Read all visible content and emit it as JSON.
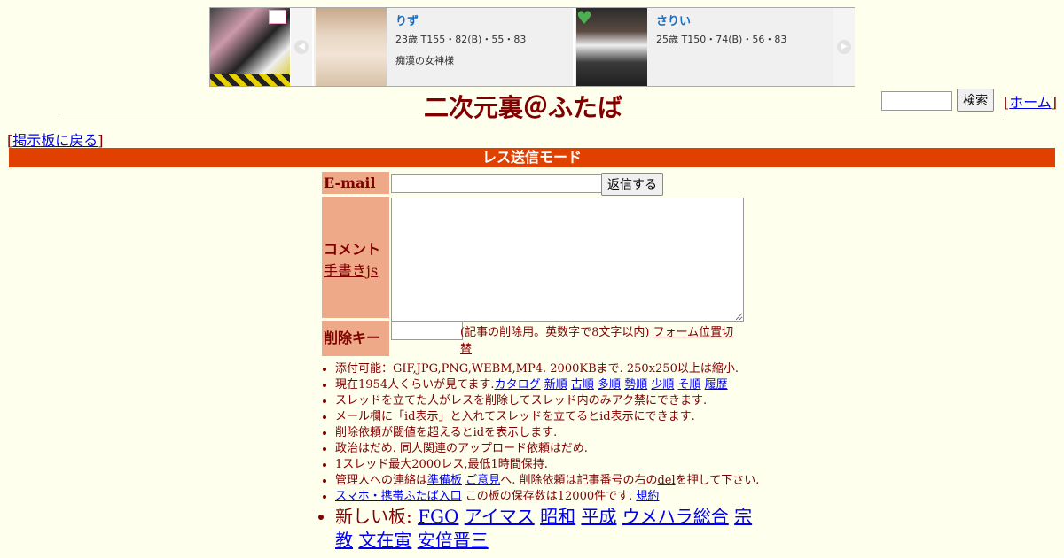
{
  "ad": {
    "cards": [
      {
        "name": "りず",
        "spec": "23歳 T155・82(B)・55・83",
        "tag": "痴漢の女神様"
      },
      {
        "name": "さりい",
        "spec": "25歳 T150・74(B)・56・83",
        "tag": ""
      }
    ],
    "prev_icon": "chevron-left-icon",
    "next_icon": "chevron-right-icon"
  },
  "header": {
    "title": "二次元裏＠ふたば",
    "search_button": "検索",
    "home_link": "ホーム",
    "bracket_open": "[",
    "bracket_close": "]"
  },
  "back_link": "掲示板に戻る",
  "mode_label": "レス送信モード",
  "form": {
    "email_label": "E-mail",
    "email_value": "",
    "reply_button": "返信する",
    "comment_label": "コメント",
    "handwriting_link": "手書きjs",
    "comment_value": "",
    "delete_key_label": "削除キー",
    "delete_key_value": "",
    "delete_key_note": "(記事の削除用。英数字で8文字以内)",
    "form_position_link": "フォーム位置切替"
  },
  "rules": {
    "attach": "添付可能：GIF,JPG,PNG,WEBM,MP4. 2000KBまで. 250x250以上は縮小.",
    "viewers_text": "現在1954人くらいが見てます.",
    "sort_links": [
      "カタログ",
      "新順",
      "古順",
      "多順",
      "勢順",
      "少順",
      "そ順",
      "履歴"
    ],
    "line3": "スレッドを立てた人がレスを削除してスレッド内のみアク禁にできます.",
    "line4": "メール欄に「id表示」と入れてスレッドを立てるとid表示にできます.",
    "line5": "削除依頼が閾値を超えるとidを表示します.",
    "line6": "政治はだめ. 同人関連のアップロード依頼はだめ.",
    "line7": "1スレッド最大2000レス,最低1時間保持.",
    "contact_prefix": "管理人への連絡は",
    "contact_link1": "準備板",
    "contact_link2": "ご意見",
    "contact_mid": "へ. 削除依頼は記事番号の右の",
    "contact_del": "del",
    "contact_suffix": "を押して下さい.",
    "mobile_link": "スマホ・携帯ふたば入口",
    "storage_text": " この板の保存数は12000件です.",
    "rules_link": "規約",
    "new_boards_label": "新しい板:",
    "new_boards": [
      "FGO",
      "アイマス",
      "昭和",
      "平成",
      "ウメハラ総合",
      "宗教",
      "文在寅",
      "安倍晋三"
    ]
  }
}
